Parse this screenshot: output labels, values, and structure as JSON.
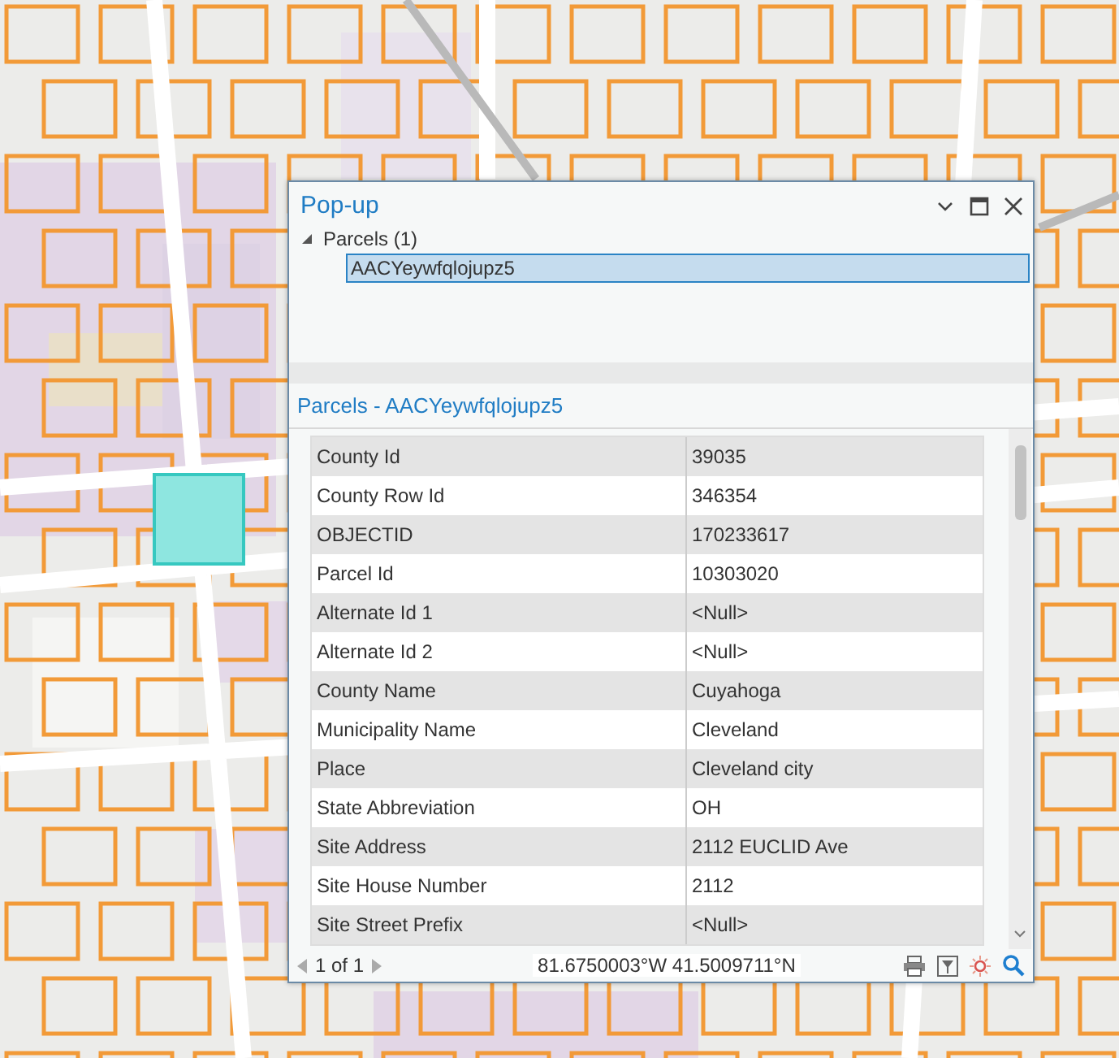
{
  "popup": {
    "title": "Pop-up",
    "tree": [
      {
        "label": "Parcels (1)",
        "expanded": true,
        "children": [
          {
            "label": "AACYeywfqlojupz5",
            "selected": true
          }
        ]
      }
    ],
    "heading": "Parcels - AACYeywfqlojupz5",
    "rows": [
      {
        "field": "County Id",
        "value": "39035"
      },
      {
        "field": "County Row Id",
        "value": "346354"
      },
      {
        "field": "OBJECTID",
        "value": "170233617"
      },
      {
        "field": "Parcel Id",
        "value": "10303020"
      },
      {
        "field": "Alternate Id 1",
        "value": "<Null>"
      },
      {
        "field": "Alternate Id 2",
        "value": "<Null>"
      },
      {
        "field": "County Name",
        "value": "Cuyahoga"
      },
      {
        "field": "Municipality Name",
        "value": "Cleveland"
      },
      {
        "field": "Place",
        "value": "Cleveland city"
      },
      {
        "field": "State Abbreviation",
        "value": "OH"
      },
      {
        "field": "Site Address",
        "value": "2112 EUCLID Ave"
      },
      {
        "field": "Site House Number",
        "value": "2112"
      },
      {
        "field": "Site Street Prefix",
        "value": "<Null>"
      }
    ],
    "pager": "1 of 1",
    "coordinates": "81.6750003°W 41.5009711°N"
  }
}
